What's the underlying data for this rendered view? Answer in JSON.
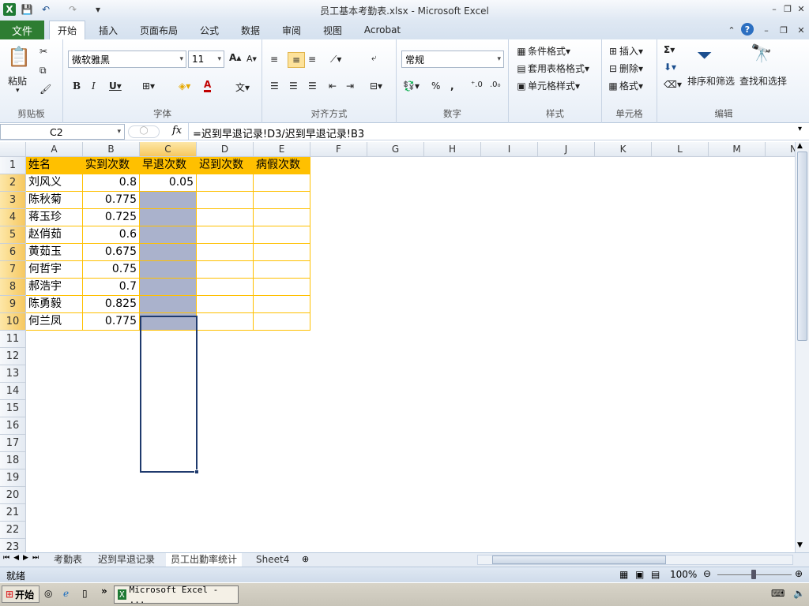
{
  "window": {
    "title": "员工基本考勤表.xlsx - Microsoft Excel",
    "app_icon": "X"
  },
  "tabs": [
    "开始",
    "插入",
    "页面布局",
    "公式",
    "数据",
    "审阅",
    "视图",
    "Acrobat"
  ],
  "file_tab": "文件",
  "active_tab": "开始",
  "ribbon": {
    "clipboard": {
      "label": "剪贴板",
      "paste": "粘贴"
    },
    "font": {
      "label": "字体",
      "family": "微软雅黑",
      "size": "11"
    },
    "alignment": {
      "label": "对齐方式"
    },
    "number": {
      "label": "数字",
      "format": "常规"
    },
    "styles": {
      "label": "样式",
      "conditional": "条件格式",
      "table": "套用表格格式",
      "cell_styles": "单元格样式"
    },
    "cells": {
      "label": "单元格",
      "insert": "插入",
      "delete": "删除",
      "format": "格式"
    },
    "editing": {
      "label": "编辑",
      "sort": "排序和筛选",
      "find": "查找和选择"
    }
  },
  "formula_bar": {
    "name_box": "C2",
    "fx": "fx",
    "formula": "=迟到早退记录!D3/迟到早退记录!B3"
  },
  "columns": [
    "A",
    "B",
    "C",
    "D",
    "E",
    "F",
    "G",
    "H",
    "I",
    "J",
    "K",
    "L",
    "M",
    "N"
  ],
  "rows": [
    "1",
    "2",
    "3",
    "4",
    "5",
    "6",
    "7",
    "8",
    "9",
    "10",
    "11",
    "12",
    "13",
    "14",
    "15",
    "16",
    "17",
    "18",
    "19",
    "20",
    "21",
    "22",
    "23"
  ],
  "table": {
    "headers": [
      "姓名",
      "实到次数",
      "早退次数",
      "迟到次数",
      "病假次数"
    ],
    "names": [
      "刘风义",
      "陈秋菊",
      "蒋玉珍",
      "赵俏茹",
      "黄茹玉",
      "何哲宇",
      "郝浩宇",
      "陈勇毅",
      "何兰凤"
    ],
    "actual": [
      "0.8",
      "0.775",
      "0.725",
      "0.6",
      "0.675",
      "0.75",
      "0.7",
      "0.825",
      "0.775"
    ],
    "early": [
      "0.05"
    ]
  },
  "sheets": [
    "考勤表",
    "迟到早退记录",
    "员工出勤率统计",
    "Sheet4"
  ],
  "active_sheet": "员工出勤率统计",
  "status": {
    "ready": "就绪",
    "zoom": "100%"
  },
  "taskbar": {
    "start": "开始",
    "task": "Microsoft Excel - ..."
  }
}
